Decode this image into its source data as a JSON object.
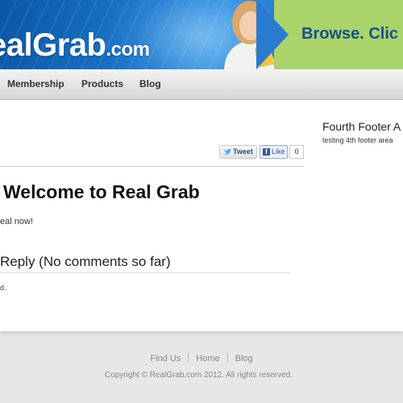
{
  "banner": {
    "logo_real": "eal",
    "logo_grab": "Grab",
    "logo_tld": ".com",
    "promo_text": "Browse. Clic"
  },
  "nav": {
    "items": [
      {
        "label": "Membership"
      },
      {
        "label": "Products"
      },
      {
        "label": "Blog"
      }
    ]
  },
  "social": {
    "tweet_label": "Tweet",
    "like_label": "Like",
    "like_count": "0"
  },
  "post": {
    "title": "Welcome to Real Grab",
    "body": "eal now!",
    "reply_heading": "Reply (No comments so far)",
    "comments_note": "d."
  },
  "sidebar": {
    "title": "Fourth Footer A",
    "text": "testing 4th footer area"
  },
  "footer": {
    "links": [
      {
        "label": "Find Us"
      },
      {
        "label": "Home"
      },
      {
        "label": "Blog"
      }
    ],
    "copyright": "Copyright © RealGrab.com 2012. All rights reserved."
  },
  "colors": {
    "banner_blue": "#1a74c9",
    "promo_green": "#a9d36b",
    "promo_text": "#1a4f8e"
  }
}
